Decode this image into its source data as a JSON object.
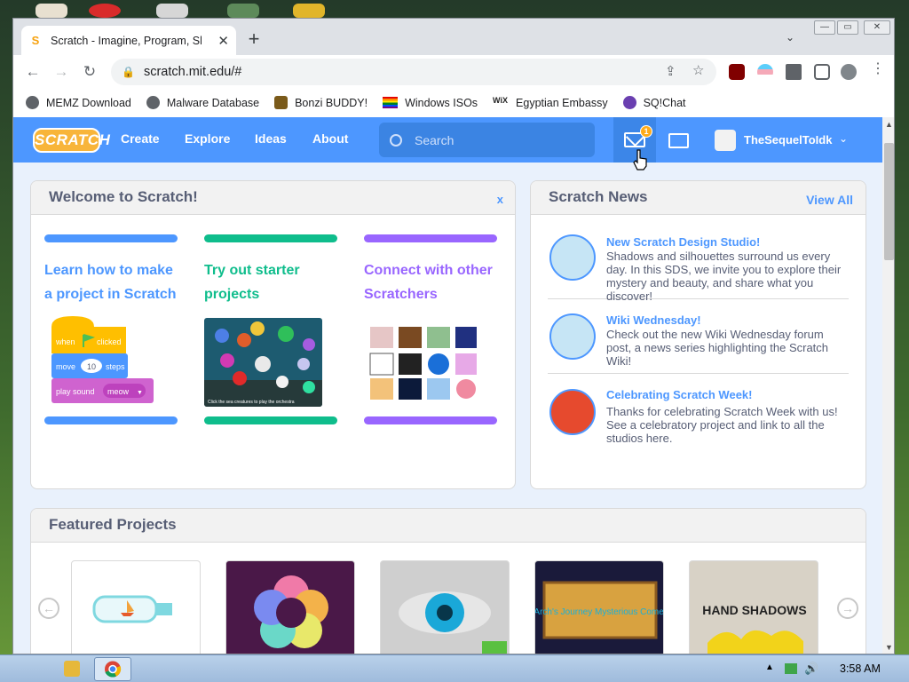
{
  "browser": {
    "tab_title": "Scratch - Imagine, Program, Share",
    "tab_close": "✕",
    "new_tab": "+",
    "url": "scratch.mit.edu/#",
    "bookmarks": [
      {
        "label": "MEMZ Download",
        "color": "#5f6368"
      },
      {
        "label": "Malware Database",
        "color": "#5f6368"
      },
      {
        "label": "Bonzi BUDDY!",
        "color": "#7a5a1a"
      },
      {
        "label": "Windows ISOs",
        "color": "#e8453c"
      },
      {
        "label": "Egyptian Embassy",
        "color": "#222222"
      },
      {
        "label": "SQ!Chat",
        "color": "#6a3fb0"
      }
    ]
  },
  "nav": {
    "logo": "SCRATCH",
    "links": [
      "Create",
      "Explore",
      "Ideas",
      "About"
    ],
    "search_placeholder": "Search",
    "message_count": "1",
    "username": "TheSequelToIdk",
    "colors": {
      "bar": "#4d97ff",
      "logo": "#f8b53a"
    }
  },
  "welcome": {
    "title": "Welcome to Scratch!",
    "close": "x",
    "columns": [
      {
        "title": "Learn how to make a project in Scratch",
        "color": "#4d97ff",
        "blocks": {
          "event_prefix": "when",
          "event_suffix": "clicked",
          "move_prefix": "move",
          "move_value": "10",
          "move_suffix": "steps",
          "sound_label": "play sound",
          "sound_value": "meow"
        }
      },
      {
        "title": "Try out starter projects",
        "color": "#0fbd8c",
        "caption": "Click the sea creatures to play the orchestra"
      },
      {
        "title": "Connect with other Scratchers",
        "color": "#9966ff"
      }
    ]
  },
  "news": {
    "title": "Scratch News",
    "view_all": "View All",
    "items": [
      {
        "title": "New Scratch Design Studio!",
        "text": "Shadows and silhouettes surround us every day. In this SDS, we invite you to explore their mystery and beauty, and share what you discover!"
      },
      {
        "title": "Wiki Wednesday!",
        "text": "Check out the new Wiki Wednesday forum post, a news series highlighting the Scratch Wiki!"
      },
      {
        "title": "Celebrating Scratch Week!",
        "text": "Thanks for celebrating Scratch Week with us! See a celebratory project and link to all the studios here."
      }
    ]
  },
  "featured": {
    "title": "Featured Projects",
    "prev": "←",
    "next": "→",
    "projects": [
      {
        "image": "bottle with boat",
        "text": ""
      },
      {
        "image": "colorful flower",
        "text": ""
      },
      {
        "image": "blue eye",
        "text": ""
      },
      {
        "image": "sign",
        "text": "Arch's Journey Mysterious Comet"
      },
      {
        "image": "hand shadows",
        "text": "HAND SHADOWS"
      }
    ]
  },
  "taskbar": {
    "clock": "3:58 AM"
  }
}
